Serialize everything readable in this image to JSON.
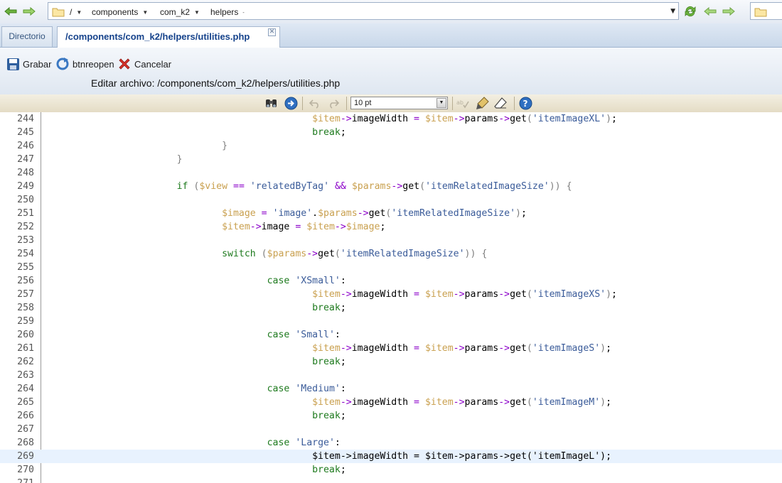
{
  "addressbar": {
    "breadcrumbs": [
      "/",
      "components",
      "com_k2",
      "helpers"
    ],
    "back_icon": "arrow-left-icon",
    "forward_icon": "arrow-right-icon",
    "refresh_icon": "refresh-icon"
  },
  "tabs": [
    {
      "label": "Directorio",
      "active": false
    },
    {
      "label": "/components/com_k2/helpers/utilities.php",
      "active": true
    }
  ],
  "toolbar": {
    "save_label": "Grabar",
    "reopen_label": "btnreopen",
    "cancel_label": "Cancelar",
    "edit_title": "Editar archivo: /components/com_k2/helpers/utilities.php"
  },
  "editor_toolbar": {
    "font_size": "10 pt"
  },
  "colors": {
    "keyword": "#1e7a1e",
    "variable": "#c9a04f",
    "operator": "#8b00c9",
    "string": "#3a5b99",
    "current_line": "#e8f2fe"
  },
  "current_line": 269,
  "code_lines": [
    {
      "n": "244",
      "tokens": [
        [
          "t",
          "\t\t\t\t\t\t"
        ],
        [
          "v",
          "$item"
        ],
        [
          "o",
          "->"
        ],
        [
          "t",
          "imageWidth "
        ],
        [
          "o",
          "="
        ],
        [
          "t",
          " "
        ],
        [
          "v",
          "$item"
        ],
        [
          "o",
          "->"
        ],
        [
          "t",
          "params"
        ],
        [
          "o",
          "->"
        ],
        [
          "t",
          "get"
        ],
        [
          "p",
          "("
        ],
        [
          "s",
          "'itemImageXL'"
        ],
        [
          "p",
          ")"
        ],
        [
          "t",
          ";"
        ]
      ]
    },
    {
      "n": "245",
      "tokens": [
        [
          "t",
          "\t\t\t\t\t\t"
        ],
        [
          "k",
          "break"
        ],
        [
          "t",
          ";"
        ]
      ]
    },
    {
      "n": "246",
      "tokens": [
        [
          "t",
          "\t\t\t\t"
        ],
        [
          "p",
          "}"
        ]
      ]
    },
    {
      "n": "247",
      "tokens": [
        [
          "t",
          "\t\t\t"
        ],
        [
          "p",
          "}"
        ]
      ]
    },
    {
      "n": "248",
      "tokens": []
    },
    {
      "n": "249",
      "tokens": [
        [
          "t",
          "\t\t\t"
        ],
        [
          "k",
          "if"
        ],
        [
          "t",
          " "
        ],
        [
          "p",
          "("
        ],
        [
          "v",
          "$view"
        ],
        [
          "t",
          " "
        ],
        [
          "o",
          "=="
        ],
        [
          "t",
          " "
        ],
        [
          "s",
          "'relatedByTag'"
        ],
        [
          "t",
          " "
        ],
        [
          "o",
          "&&"
        ],
        [
          "t",
          " "
        ],
        [
          "v",
          "$params"
        ],
        [
          "o",
          "->"
        ],
        [
          "t",
          "get"
        ],
        [
          "p",
          "("
        ],
        [
          "s",
          "'itemRelatedImageSize'"
        ],
        [
          "p",
          "))"
        ],
        [
          "t",
          " "
        ],
        [
          "p",
          "{"
        ]
      ]
    },
    {
      "n": "250",
      "tokens": []
    },
    {
      "n": "251",
      "tokens": [
        [
          "t",
          "\t\t\t\t"
        ],
        [
          "v",
          "$image"
        ],
        [
          "t",
          " "
        ],
        [
          "o",
          "="
        ],
        [
          "t",
          " "
        ],
        [
          "s",
          "'image'"
        ],
        [
          "t",
          "."
        ],
        [
          "v",
          "$params"
        ],
        [
          "o",
          "->"
        ],
        [
          "t",
          "get"
        ],
        [
          "p",
          "("
        ],
        [
          "s",
          "'itemRelatedImageSize'"
        ],
        [
          "p",
          ")"
        ],
        [
          "t",
          ";"
        ]
      ]
    },
    {
      "n": "252",
      "tokens": [
        [
          "t",
          "\t\t\t\t"
        ],
        [
          "v",
          "$item"
        ],
        [
          "o",
          "->"
        ],
        [
          "t",
          "image "
        ],
        [
          "o",
          "="
        ],
        [
          "t",
          " "
        ],
        [
          "v",
          "$item"
        ],
        [
          "o",
          "->"
        ],
        [
          "v",
          "$image"
        ],
        [
          "t",
          ";"
        ]
      ]
    },
    {
      "n": "253",
      "tokens": []
    },
    {
      "n": "254",
      "tokens": [
        [
          "t",
          "\t\t\t\t"
        ],
        [
          "k",
          "switch"
        ],
        [
          "t",
          " "
        ],
        [
          "p",
          "("
        ],
        [
          "v",
          "$params"
        ],
        [
          "o",
          "->"
        ],
        [
          "t",
          "get"
        ],
        [
          "p",
          "("
        ],
        [
          "s",
          "'itemRelatedImageSize'"
        ],
        [
          "p",
          "))"
        ],
        [
          "t",
          " "
        ],
        [
          "p",
          "{"
        ]
      ]
    },
    {
      "n": "255",
      "tokens": []
    },
    {
      "n": "256",
      "tokens": [
        [
          "t",
          "\t\t\t\t\t"
        ],
        [
          "k",
          "case"
        ],
        [
          "t",
          " "
        ],
        [
          "s",
          "'XSmall'"
        ],
        [
          "t",
          ":"
        ]
      ]
    },
    {
      "n": "257",
      "tokens": [
        [
          "t",
          "\t\t\t\t\t\t"
        ],
        [
          "v",
          "$item"
        ],
        [
          "o",
          "->"
        ],
        [
          "t",
          "imageWidth "
        ],
        [
          "o",
          "="
        ],
        [
          "t",
          " "
        ],
        [
          "v",
          "$item"
        ],
        [
          "o",
          "->"
        ],
        [
          "t",
          "params"
        ],
        [
          "o",
          "->"
        ],
        [
          "t",
          "get"
        ],
        [
          "p",
          "("
        ],
        [
          "s",
          "'itemImageXS'"
        ],
        [
          "p",
          ")"
        ],
        [
          "t",
          ";"
        ]
      ]
    },
    {
      "n": "258",
      "tokens": [
        [
          "t",
          "\t\t\t\t\t\t"
        ],
        [
          "k",
          "break"
        ],
        [
          "t",
          ";"
        ]
      ]
    },
    {
      "n": "259",
      "tokens": []
    },
    {
      "n": "260",
      "tokens": [
        [
          "t",
          "\t\t\t\t\t"
        ],
        [
          "k",
          "case"
        ],
        [
          "t",
          " "
        ],
        [
          "s",
          "'Small'"
        ],
        [
          "t",
          ":"
        ]
      ]
    },
    {
      "n": "261",
      "tokens": [
        [
          "t",
          "\t\t\t\t\t\t"
        ],
        [
          "v",
          "$item"
        ],
        [
          "o",
          "->"
        ],
        [
          "t",
          "imageWidth "
        ],
        [
          "o",
          "="
        ],
        [
          "t",
          " "
        ],
        [
          "v",
          "$item"
        ],
        [
          "o",
          "->"
        ],
        [
          "t",
          "params"
        ],
        [
          "o",
          "->"
        ],
        [
          "t",
          "get"
        ],
        [
          "p",
          "("
        ],
        [
          "s",
          "'itemImageS'"
        ],
        [
          "p",
          ")"
        ],
        [
          "t",
          ";"
        ]
      ]
    },
    {
      "n": "262",
      "tokens": [
        [
          "t",
          "\t\t\t\t\t\t"
        ],
        [
          "k",
          "break"
        ],
        [
          "t",
          ";"
        ]
      ]
    },
    {
      "n": "263",
      "tokens": []
    },
    {
      "n": "264",
      "tokens": [
        [
          "t",
          "\t\t\t\t\t"
        ],
        [
          "k",
          "case"
        ],
        [
          "t",
          " "
        ],
        [
          "s",
          "'Medium'"
        ],
        [
          "t",
          ":"
        ]
      ]
    },
    {
      "n": "265",
      "tokens": [
        [
          "t",
          "\t\t\t\t\t\t"
        ],
        [
          "v",
          "$item"
        ],
        [
          "o",
          "->"
        ],
        [
          "t",
          "imageWidth "
        ],
        [
          "o",
          "="
        ],
        [
          "t",
          " "
        ],
        [
          "v",
          "$item"
        ],
        [
          "o",
          "->"
        ],
        [
          "t",
          "params"
        ],
        [
          "o",
          "->"
        ],
        [
          "t",
          "get"
        ],
        [
          "p",
          "("
        ],
        [
          "s",
          "'itemImageM'"
        ],
        [
          "p",
          ")"
        ],
        [
          "t",
          ";"
        ]
      ]
    },
    {
      "n": "266",
      "tokens": [
        [
          "t",
          "\t\t\t\t\t\t"
        ],
        [
          "k",
          "break"
        ],
        [
          "t",
          ";"
        ]
      ]
    },
    {
      "n": "267",
      "tokens": []
    },
    {
      "n": "268",
      "tokens": [
        [
          "t",
          "\t\t\t\t\t"
        ],
        [
          "k",
          "case"
        ],
        [
          "t",
          " "
        ],
        [
          "s",
          "'Large'"
        ],
        [
          "t",
          ":"
        ]
      ]
    },
    {
      "n": "269",
      "tokens": [
        [
          "t",
          "\t\t\t\t\t\t"
        ],
        [
          "v",
          "$item"
        ],
        [
          "o",
          "->"
        ],
        [
          "t",
          "imageWidth "
        ],
        [
          "o",
          "="
        ],
        [
          "t",
          " "
        ],
        [
          "v",
          "$item"
        ],
        [
          "o",
          "->"
        ],
        [
          "t",
          "params"
        ],
        [
          "o",
          "->"
        ],
        [
          "t",
          "get"
        ],
        [
          "p",
          "("
        ],
        [
          "s",
          "'itemImageL'"
        ],
        [
          "p",
          ")"
        ],
        [
          "t",
          ";"
        ]
      ]
    },
    {
      "n": "270",
      "tokens": [
        [
          "t",
          "\t\t\t\t\t\t"
        ],
        [
          "k",
          "break"
        ],
        [
          "t",
          ";"
        ]
      ]
    },
    {
      "n": "271",
      "tokens": []
    }
  ]
}
